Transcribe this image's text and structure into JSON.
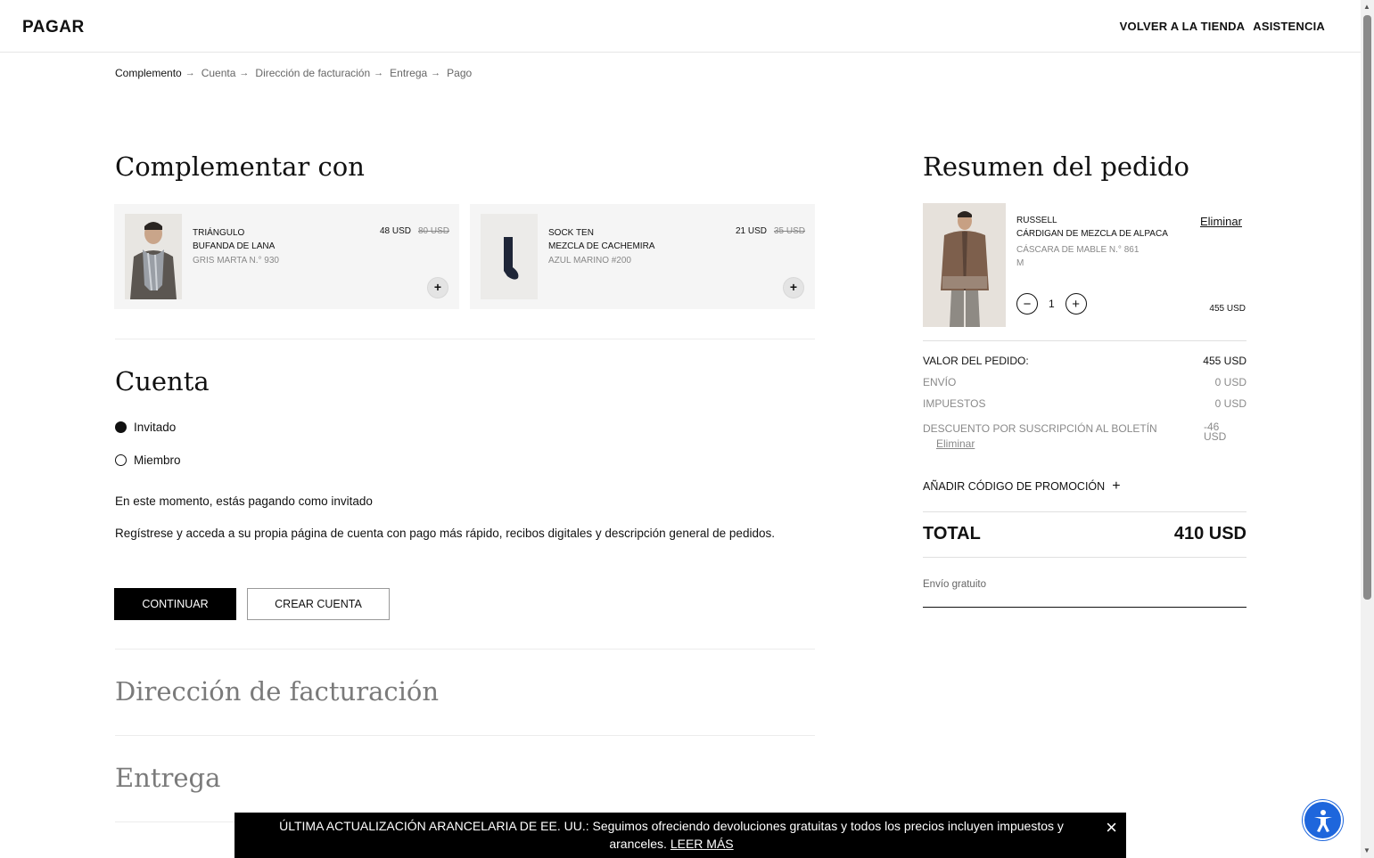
{
  "header": {
    "logo": "PAGAR",
    "nav": [
      "VOLVER A LA TIENDA",
      "ASISTENCIA"
    ]
  },
  "breadcrumb": [
    "Complemento",
    "Cuenta",
    "Dirección de facturación",
    "Entrega",
    "Pago"
  ],
  "complement": {
    "title": "Complementar con",
    "products": [
      {
        "name_line1": "TRIÁNGULO",
        "name_line2": "BUFANDA DE LANA",
        "color": "GRIS MARTA N.° 930",
        "price": "48 USD",
        "old_price": "80 USD"
      },
      {
        "name_line1": "SOCK TEN",
        "name_line2": "MEZCLA DE CACHEMIRA",
        "color": "AZUL MARINO #200",
        "price": "21 USD",
        "old_price": "35 USD"
      }
    ]
  },
  "account": {
    "title": "Cuenta",
    "options": [
      "Invitado",
      "Miembro"
    ],
    "selected": "Invitado",
    "status_text": "En este momento, estás pagando como invitado",
    "register_text": "Regístrese y acceda a su propia página de cuenta con pago más rápido, recibos digitales y descripción general de pedidos.",
    "continue_label": "CONTINUAR",
    "create_label": "CREAR CUENTA"
  },
  "sections": {
    "billing": "Dirección de facturación",
    "delivery": "Entrega"
  },
  "summary": {
    "title": "Resumen del pedido",
    "item": {
      "brand": "RUSSELL",
      "name": "CÁRDIGAN DE MEZCLA DE ALPACA",
      "color": "CÁSCARA DE MABLE N.° 861",
      "size": "M",
      "quantity": "1",
      "price": "455 USD",
      "remove_label": "Eliminar"
    },
    "order_value_label": "VALOR DEL PEDIDO:",
    "order_value": "455 USD",
    "shipping_label": "ENVÍO",
    "shipping": "0 USD",
    "tax_label": "IMPUESTOS",
    "tax": "0 USD",
    "discount_label": "DESCUENTO POR SUSCRIPCIÓN AL BOLETÍN",
    "discount_line1": "-46",
    "discount_line2": "USD",
    "discount_remove": "Eliminar",
    "promo_label": "AÑADIR CÓDIGO DE PROMOCIÓN",
    "total_label": "TOTAL",
    "total": "410 USD",
    "free_shipping": "Envío gratuito"
  },
  "banner": {
    "text": "ÚLTIMA ACTUALIZACIÓN ARANCELARIA DE EE. UU.: Seguimos ofreciendo devoluciones gratuitas y todos los precios incluyen impuestos y aranceles.",
    "link": "LEER MÁS"
  }
}
